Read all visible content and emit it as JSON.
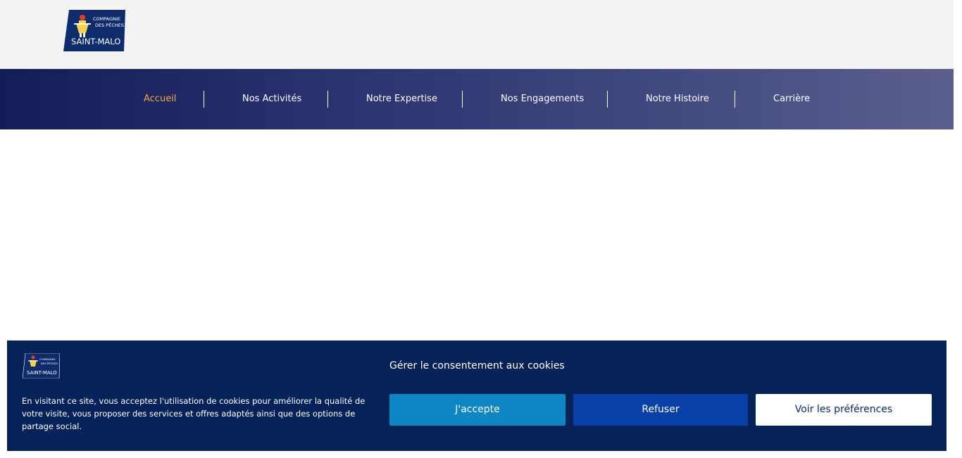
{
  "brand": {
    "logo_line1": "COMPAGNIE",
    "logo_line2": "DES PÊCHES",
    "logo_line3": "SAINT-MALO",
    "logo_bg_color": "#0e2c6b"
  },
  "nav": {
    "items": [
      {
        "label": "Accueil",
        "active": true
      },
      {
        "label": "Nos Activités",
        "active": false
      },
      {
        "label": "Notre Expertise",
        "active": false
      },
      {
        "label": "Nos Engagements",
        "active": false
      },
      {
        "label": "Notre Histoire",
        "active": false
      },
      {
        "label": "Carrière",
        "active": false
      }
    ],
    "active_color": "#f0a93b"
  },
  "cookie_banner": {
    "title": "Gérer le consentement aux cookies",
    "text": "En visitant ce site, vous acceptez l'utilisation de cookies pour améliorer la qualité de votre visite, vous proposer des services et offres adaptés ainsi que des options de partage social.",
    "accept_label": "J'accepte",
    "refuse_label": "Refuser",
    "prefs_label": "Voir les préférences",
    "bg_color": "#052358"
  }
}
